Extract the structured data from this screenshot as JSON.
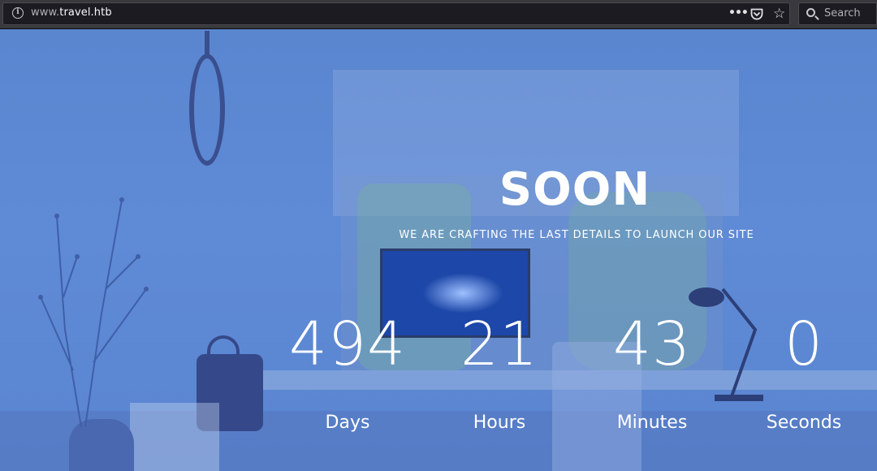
{
  "browser": {
    "url_prefix": "www.",
    "url_host": "travel.htb",
    "page_actions_icon": "ellipsis-icon",
    "pocket_icon": "pocket-icon",
    "bookmark_icon": "star-icon",
    "search_placeholder": "Search"
  },
  "hero": {
    "title": "SOON",
    "subtitle": "WE ARE CRAFTING THE LAST DETAILS TO LAUNCH OUR SITE"
  },
  "countdown": [
    {
      "value": "494",
      "unit": "Days"
    },
    {
      "value": "21",
      "unit": "Hours"
    },
    {
      "value": "43",
      "unit": "Minutes"
    },
    {
      "value": "0",
      "unit": "Seconds"
    }
  ],
  "colors": {
    "overlay": "#5a86d0",
    "text": "#ffffff",
    "chrome": "#38383d"
  }
}
